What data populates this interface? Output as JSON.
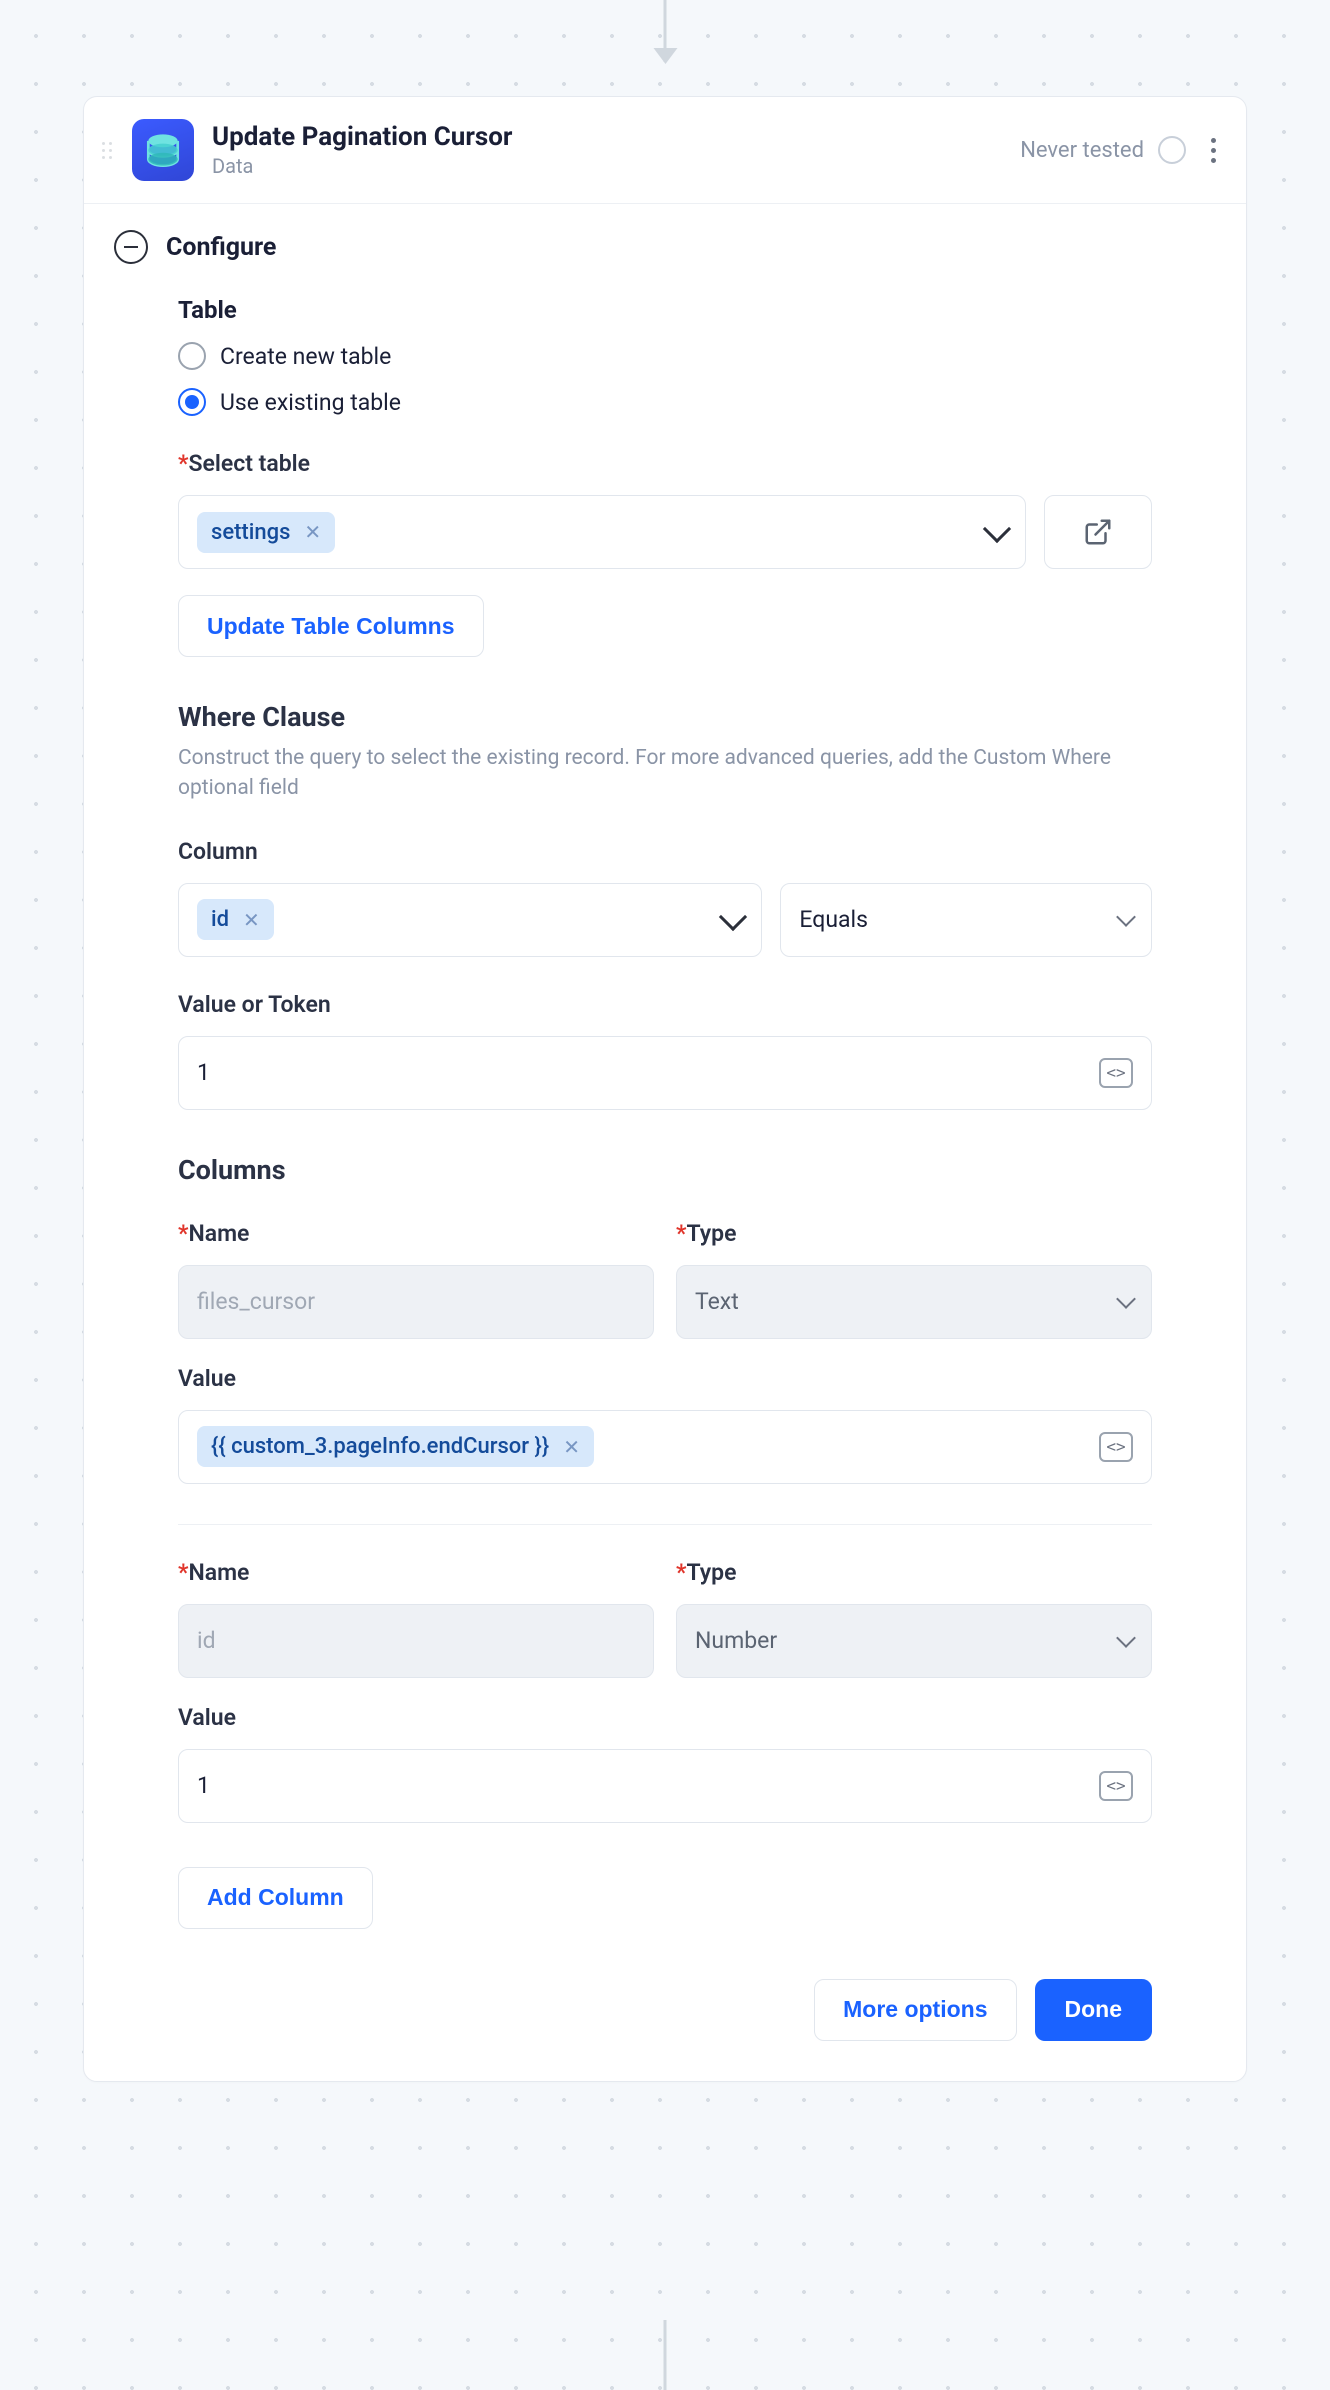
{
  "header": {
    "title": "Update Pagination Cursor",
    "subtitle": "Data",
    "status": "Never tested"
  },
  "configure_label": "Configure",
  "table_section": {
    "label": "Table",
    "radio_create": "Create new table",
    "radio_existing": "Use existing table",
    "select_label": "Select table",
    "selected_table": "settings",
    "update_columns_btn": "Update Table Columns"
  },
  "where_section": {
    "heading": "Where Clause",
    "desc": "Construct the query to select the existing record. For more advanced queries, add the Custom Where optional field",
    "column_label": "Column",
    "column_chip": "id",
    "operator": "Equals",
    "value_label": "Value or Token",
    "value": "1"
  },
  "columns_section": {
    "heading": "Columns",
    "name_label": "Name",
    "type_label": "Type",
    "value_label": "Value",
    "rows": [
      {
        "name_placeholder": "files_cursor",
        "type": "Text",
        "value_token": "{{ custom_3.pageInfo.endCursor }}"
      },
      {
        "name_placeholder": "id",
        "type": "Number",
        "value_plain": "1"
      }
    ],
    "add_column_btn": "Add Column"
  },
  "footer": {
    "more_options": "More options",
    "done": "Done"
  }
}
